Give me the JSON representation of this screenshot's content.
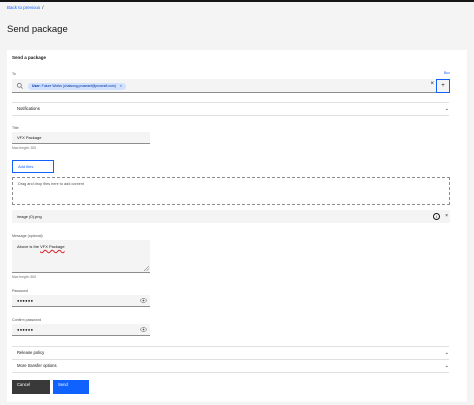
{
  "breadcrumb": {
    "back_label": "Back to previous",
    "separator": "/"
  },
  "page": {
    "title": "Send package"
  },
  "form": {
    "section_title": "Send a package",
    "to": {
      "label": "To",
      "bcc_label": "Bcc",
      "recipient_tag": {
        "prefix": "User:",
        "text": "Future Works (chatsong.pruseaet@prowrsft.com)"
      },
      "clear_symbol": "×",
      "add_symbol": "+"
    },
    "notifications_label": "Notifications",
    "title_field": {
      "label": "Title",
      "value": "VFX Package",
      "helper": "Max length: 300"
    },
    "add_files_label": "Add files",
    "dropzone_text": "Drag and drop files here to add content",
    "file": {
      "name": "image (0).png"
    },
    "message": {
      "label": "Message (optional)",
      "value_plain": "Above is the ",
      "value_underlined": "VFX Package",
      "helper": "Max length: 800"
    },
    "password": {
      "label": "Password",
      "value": "●●●●●●"
    },
    "confirm_password": {
      "label": "Confirm password",
      "value": "●●●●●●"
    },
    "release_policy_label": "Release policy",
    "more_options_label": "More transfer options",
    "cancel_label": "Cancel",
    "send_label": "Send"
  },
  "colors": {
    "accent": "#0f62fe",
    "dark_button": "#393939",
    "tag_bg": "#d0e2ff"
  },
  "icons": [
    "search-icon",
    "close-icon",
    "add-icon",
    "chevron-down-icon",
    "info-icon",
    "eye-icon",
    "resize-handle-icon"
  ]
}
